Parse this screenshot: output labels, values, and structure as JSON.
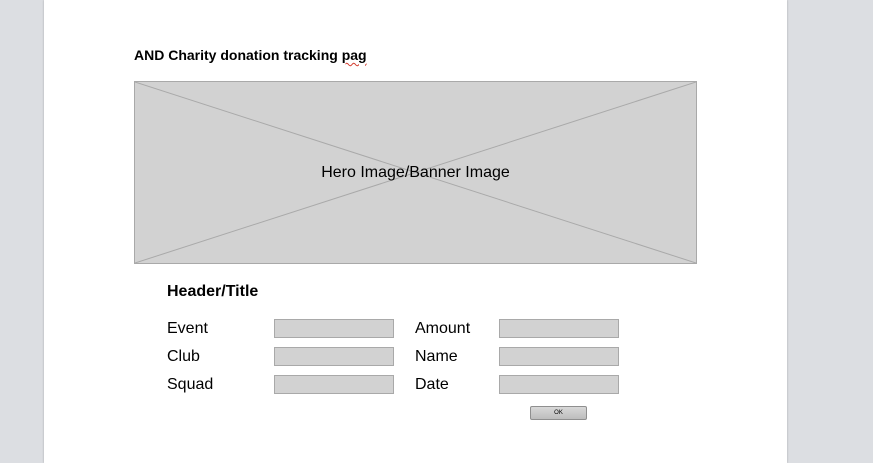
{
  "document": {
    "title_main": "AND Charity donation tracking ",
    "title_misspelled": "pag"
  },
  "hero": {
    "label": "Hero Image/Banner Image"
  },
  "form": {
    "title": "Header/Title",
    "left_fields": [
      {
        "label": "Event",
        "value": ""
      },
      {
        "label": "Club",
        "value": ""
      },
      {
        "label": "Squad",
        "value": ""
      }
    ],
    "right_fields": [
      {
        "label": "Amount",
        "value": ""
      },
      {
        "label": "Name",
        "value": ""
      },
      {
        "label": "Date",
        "value": ""
      }
    ],
    "ok_label": "OK"
  },
  "colors": {
    "background": "#dcdee2",
    "page": "#ffffff",
    "placeholder_fill": "#d2d2d2",
    "placeholder_border": "#a9a9a9"
  }
}
